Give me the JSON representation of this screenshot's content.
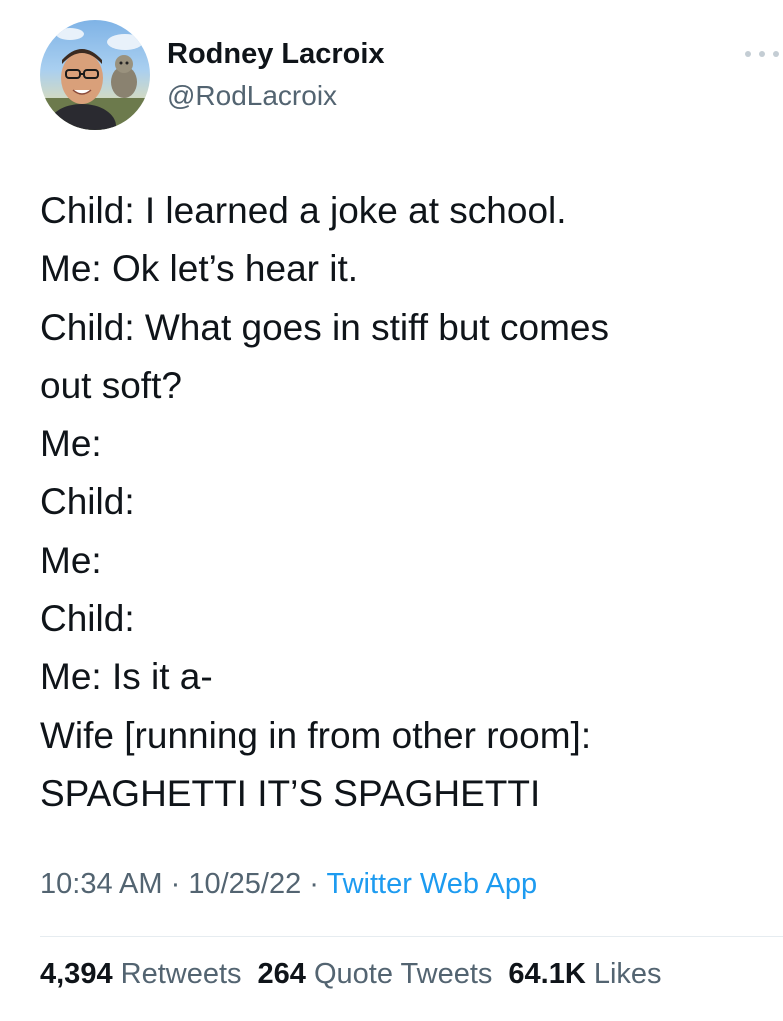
{
  "author": {
    "name": "Rodney Lacroix",
    "handle": "@RodLacroix"
  },
  "tweet": {
    "lines": [
      "Child: I learned a joke at school.",
      "Me: Ok let’s hear it.",
      "Child: What goes in stiff but comes",
      "out soft?",
      "Me:",
      "Child:",
      "Me:",
      "Child:",
      "Me: Is it a-",
      "Wife [running in from other room]:",
      "SPAGHETTI IT’S SPAGHETTI"
    ]
  },
  "meta": {
    "time": "10:34 AM",
    "separator": " · ",
    "date": "10/25/22",
    "source": "Twitter Web App"
  },
  "stats": {
    "retweets_count": "4,394",
    "retweets_label": "Retweets",
    "quotes_count": "264",
    "quotes_label": "Quote Tweets",
    "likes_count": "64.1K",
    "likes_label": "Likes"
  },
  "colors": {
    "text": "#0f1419",
    "secondary": "#536471",
    "link": "#1d9bf0",
    "divider": "#e6ecf0"
  },
  "icons": {
    "more": "more-horizontal-icon"
  }
}
